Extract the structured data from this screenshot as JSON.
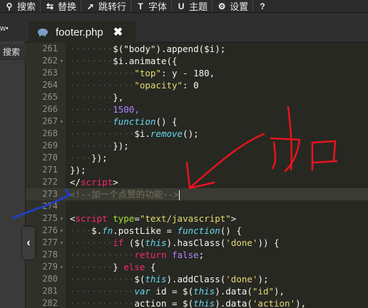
{
  "toolbar": {
    "items": [
      {
        "label": "搜索",
        "icon": "search-icon"
      },
      {
        "label": "替换",
        "icon": "replace-icon"
      },
      {
        "label": "跳转行",
        "icon": "goto-line-icon"
      },
      {
        "label": "字体",
        "icon": "font-icon"
      },
      {
        "label": "主题",
        "icon": "theme-icon"
      },
      {
        "label": "设置",
        "icon": "gear-icon"
      }
    ],
    "help_icon": "help-icon"
  },
  "left_panel": {
    "top_text": "w•",
    "search_label": "搜索",
    "collapse_symbol": "‹"
  },
  "tab": {
    "filename": "footer.php",
    "close_symbol": "✖"
  },
  "editor": {
    "lines": [
      {
        "n": "261",
        "fold": false
      },
      {
        "n": "262",
        "fold": true
      },
      {
        "n": "263",
        "fold": false
      },
      {
        "n": "264",
        "fold": false
      },
      {
        "n": "265",
        "fold": false
      },
      {
        "n": "266",
        "fold": false
      },
      {
        "n": "267",
        "fold": true
      },
      {
        "n": "268",
        "fold": false
      },
      {
        "n": "269",
        "fold": false
      },
      {
        "n": "270",
        "fold": false
      },
      {
        "n": "271",
        "fold": false
      },
      {
        "n": "272",
        "fold": false
      },
      {
        "n": "273",
        "fold": false
      },
      {
        "n": "274",
        "fold": false
      },
      {
        "n": "275",
        "fold": true
      },
      {
        "n": "276",
        "fold": true
      },
      {
        "n": "277",
        "fold": true
      },
      {
        "n": "278",
        "fold": false
      },
      {
        "n": "279",
        "fold": true
      },
      {
        "n": "280",
        "fold": false
      },
      {
        "n": "281",
        "fold": false
      },
      {
        "n": "282",
        "fold": false
      }
    ],
    "code": {
      "l261": "$(\"body\").append($i);",
      "l262_a": "$i.animate({",
      "l263_key": "\"top\"",
      "l263_rest": ": y - 180,",
      "l264_key": "\"opacity\"",
      "l264_rest": ": 0",
      "l265": "},",
      "l266": "1500,",
      "l267_kw": "function",
      "l267_rest": "() {",
      "l268_a": "$i.",
      "l268_fn": "remove",
      "l268_b": "();",
      "l269": "});",
      "l270": "});",
      "l271": "});",
      "l272_a": "</",
      "l272_tag": "script",
      "l272_b": ">",
      "l273_comment": "<!--加一个点赞的功能-->",
      "l275_a": "<",
      "l275_tag": "script",
      "l275_attr": " type",
      "l275_eq": "=",
      "l275_val": "\"text/javascript\"",
      "l275_b": ">",
      "l276_a": "$.",
      "l276_fn": "fn",
      "l276_b": ".postLike = ",
      "l276_kw": "function",
      "l276_c": "() {",
      "l277_kw": "if",
      "l277_a": " ($(",
      "l277_this": "this",
      "l277_b": ").hasClass(",
      "l277_str": "'done'",
      "l277_c": ")) {",
      "l278_kw": "return",
      "l278_val": " false",
      "l278_end": ";",
      "l279_a": "} ",
      "l279_kw": "else",
      "l279_b": " {",
      "l280_a": "$(",
      "l280_this": "this",
      "l280_b": ").addClass(",
      "l280_str": "'done'",
      "l280_c": ");",
      "l281_kw": "var",
      "l281_a": " id = $(",
      "l281_this": "this",
      "l281_b": ").data(",
      "l281_str": "\"id\"",
      "l281_c": "),",
      "l282_a": "action = $(",
      "l282_this": "this",
      "l282_b": ").data(",
      "l282_str": "'action'",
      "l282_c": "),"
    }
  },
  "annotation": {
    "handwritten_text": "加",
    "colors": {
      "red": "#e8141c",
      "blue": "#1e3fd6"
    }
  },
  "colors": {
    "background": "#272822",
    "keyword": "#f92672",
    "string": "#e6db74",
    "function": "#a6e22e",
    "number": "#ae81ff",
    "comment": "#75715e"
  }
}
